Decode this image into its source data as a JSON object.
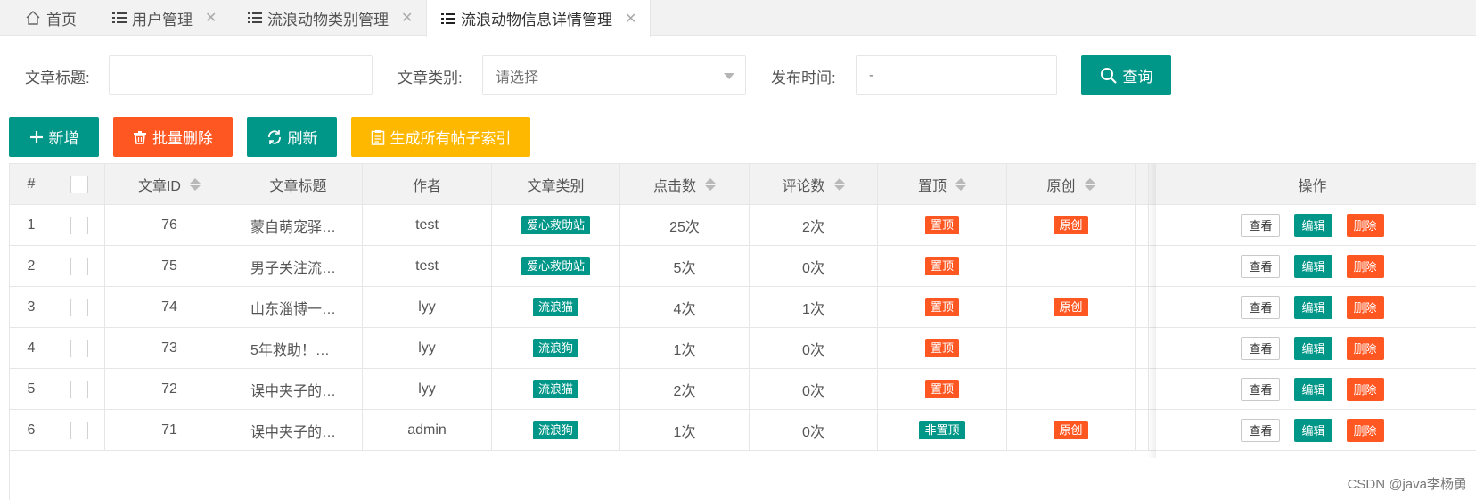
{
  "tabs": [
    {
      "label": "首页",
      "icon": "home-icon",
      "closable": false
    },
    {
      "label": "用户管理",
      "icon": "list-icon",
      "closable": true
    },
    {
      "label": "流浪动物类别管理",
      "icon": "list-icon",
      "closable": true
    },
    {
      "label": "流浪动物信息详情管理",
      "icon": "list-icon",
      "closable": true,
      "active": true
    }
  ],
  "search": {
    "title_label": "文章标题:",
    "title_value": "",
    "category_label": "文章类别:",
    "category_placeholder": "请选择",
    "date_label": "发布时间:",
    "date_value": "-",
    "query_button": "查询"
  },
  "toolbar": {
    "add": "新增",
    "batch_delete": "批量删除",
    "refresh": "刷新",
    "generate_index": "生成所有帖子索引"
  },
  "table": {
    "headers": [
      "#",
      "",
      "文章ID",
      "文章标题",
      "作者",
      "文章类别",
      "点击数",
      "评论数",
      "置顶",
      "原创",
      "操作"
    ],
    "rows": [
      {
        "no": "1",
        "id": "76",
        "title": "蒙自萌宠驿…",
        "author": "test",
        "category": "爱心救助站",
        "clicks": "25次",
        "comments": "2次",
        "top": "置顶",
        "original": "原创"
      },
      {
        "no": "2",
        "id": "75",
        "title": "男子关注流…",
        "author": "test",
        "category": "爱心救助站",
        "clicks": "5次",
        "comments": "0次",
        "top": "置顶",
        "original": ""
      },
      {
        "no": "3",
        "id": "74",
        "title": "山东淄博一…",
        "author": "lyy",
        "category": "流浪猫",
        "clicks": "4次",
        "comments": "1次",
        "top": "置顶",
        "original": "原创"
      },
      {
        "no": "4",
        "id": "73",
        "title": "5年救助！…",
        "author": "lyy",
        "category": "流浪狗",
        "clicks": "1次",
        "comments": "0次",
        "top": "置顶",
        "original": ""
      },
      {
        "no": "5",
        "id": "72",
        "title": "误中夹子的…",
        "author": "lyy",
        "category": "流浪猫",
        "clicks": "2次",
        "comments": "0次",
        "top": "置顶",
        "original": ""
      },
      {
        "no": "6",
        "id": "71",
        "title": "误中夹子的…",
        "author": "admin",
        "category": "流浪狗",
        "clicks": "1次",
        "comments": "0次",
        "top": "非置顶",
        "original": "原创"
      }
    ],
    "actions": {
      "view": "查看",
      "edit": "编辑",
      "delete": "删除"
    }
  },
  "watermark": "CSDN @java李杨勇",
  "colors": {
    "teal": "#009688",
    "orange": "#ff5722",
    "yellow": "#ffb800"
  }
}
